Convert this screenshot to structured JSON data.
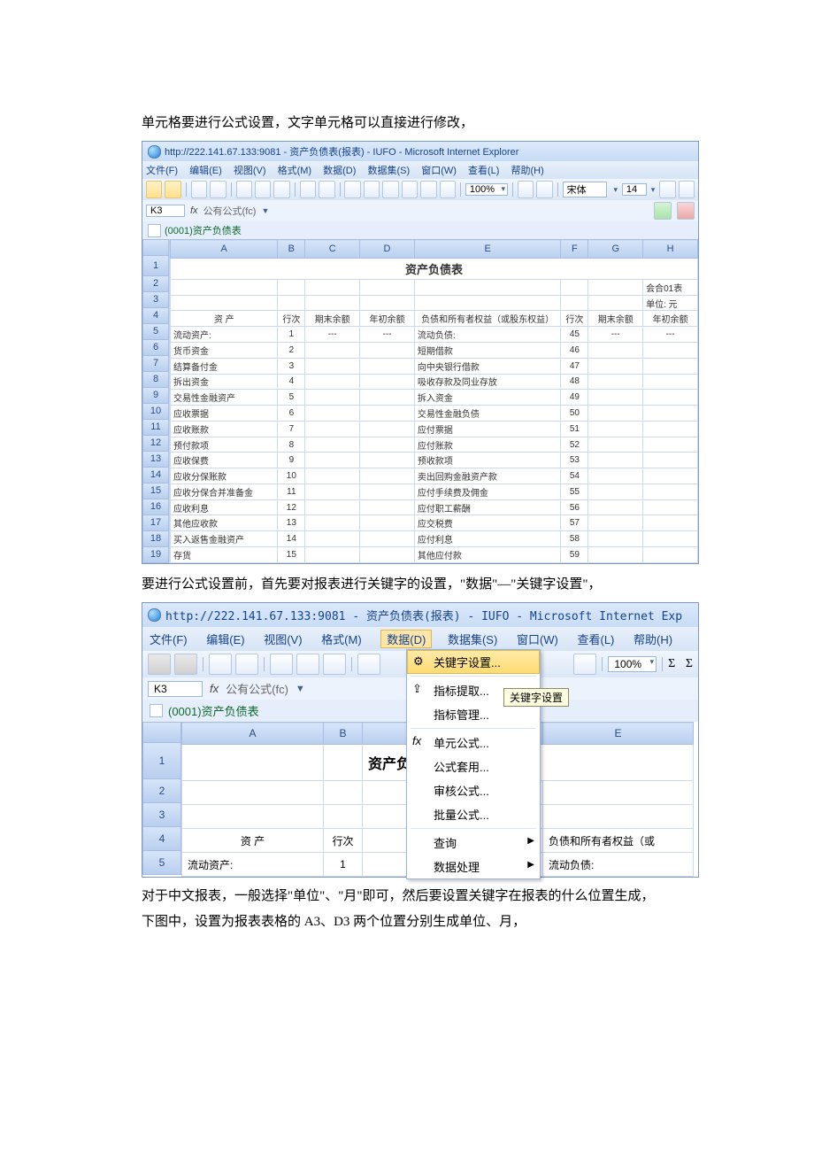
{
  "para1": "单元格要进行公式设置，文字单元格可以直接进行修改，",
  "para2": "要进行公式设置前，首先要对报表进行关键字的设置，\"数据\"—\"关键字设置\"，",
  "para3a": "对于中文报表，一般选择\"单位\"、\"月\"即可，然后要设置关键字在报表的什么位置生成，",
  "para3b": "下图中，设置为报表表格的 A3、D3 两个位置分别生成单位、月，",
  "shot1": {
    "title_url": "http://222.141.67.133:9081 - 资产负债表(报表) - IUFO - Microsoft Internet Explorer",
    "menus": [
      "文件(F)",
      "编辑(E)",
      "视图(V)",
      "格式(M)",
      "数据(D)",
      "数据集(S)",
      "窗口(W)",
      "查看(L)",
      "帮助(H)"
    ],
    "zoom": "100%",
    "font_name": "宋体",
    "font_size": "14",
    "cell_ref": "K3",
    "fx_label": "fx",
    "formula_mode": "公有公式(fc)",
    "tab": "(0001)资产负债表",
    "cols": [
      "A",
      "B",
      "C",
      "D",
      "E",
      "F",
      "G",
      "H"
    ],
    "row_numbers": [
      "1",
      "2",
      "3",
      "4",
      "5",
      "6",
      "7",
      "8",
      "9",
      "10",
      "11",
      "12",
      "13",
      "14",
      "15",
      "16",
      "17",
      "18",
      "19"
    ],
    "title_cell": "资产负债表",
    "r2_h": "会合01表",
    "r3_h": "单位: 元",
    "head": {
      "A": "资 产",
      "B": "行次",
      "C": "期末余额",
      "D": "年初余额",
      "E": "负债和所有者权益（或股东权益）",
      "F": "行次",
      "G": "期末余额",
      "H": "年初余额"
    },
    "rows": [
      {
        "A": "流动资产:",
        "B": "1",
        "C": "---",
        "D": "---",
        "E": "流动负债:",
        "F": "45",
        "G": "---",
        "H": "---"
      },
      {
        "A": "  货币资金",
        "B": "2",
        "C": "",
        "D": "",
        "E": "  短期借款",
        "F": "46",
        "G": "",
        "H": ""
      },
      {
        "A": "  结算备付金",
        "B": "3",
        "C": "",
        "D": "",
        "E": "  向中央银行借款",
        "F": "47",
        "G": "",
        "H": ""
      },
      {
        "A": "  拆出资金",
        "B": "4",
        "C": "",
        "D": "",
        "E": "  吸收存款及同业存放",
        "F": "48",
        "G": "",
        "H": ""
      },
      {
        "A": "  交易性金融资产",
        "B": "5",
        "C": "",
        "D": "",
        "E": "  拆入资金",
        "F": "49",
        "G": "",
        "H": ""
      },
      {
        "A": "  应收票据",
        "B": "6",
        "C": "",
        "D": "",
        "E": "  交易性金融负债",
        "F": "50",
        "G": "",
        "H": ""
      },
      {
        "A": "  应收账款",
        "B": "7",
        "C": "",
        "D": "",
        "E": "  应付票据",
        "F": "51",
        "G": "",
        "H": ""
      },
      {
        "A": "  预付款项",
        "B": "8",
        "C": "",
        "D": "",
        "E": "  应付账款",
        "F": "52",
        "G": "",
        "H": ""
      },
      {
        "A": "  应收保费",
        "B": "9",
        "C": "",
        "D": "",
        "E": "  预收款项",
        "F": "53",
        "G": "",
        "H": ""
      },
      {
        "A": "  应收分保账款",
        "B": "10",
        "C": "",
        "D": "",
        "E": "  卖出回购金融资产款",
        "F": "54",
        "G": "",
        "H": ""
      },
      {
        "A": "  应收分保合并准备金",
        "B": "11",
        "C": "",
        "D": "",
        "E": "  应付手续费及佣金",
        "F": "55",
        "G": "",
        "H": ""
      },
      {
        "A": "  应收利息",
        "B": "12",
        "C": "",
        "D": "",
        "E": "  应付职工薪酬",
        "F": "56",
        "G": "",
        "H": ""
      },
      {
        "A": "  其他应收款",
        "B": "13",
        "C": "",
        "D": "",
        "E": "  应交税费",
        "F": "57",
        "G": "",
        "H": ""
      },
      {
        "A": "  买入返售金融资产",
        "B": "14",
        "C": "",
        "D": "",
        "E": "  应付利息",
        "F": "58",
        "G": "",
        "H": ""
      },
      {
        "A": "  存货",
        "B": "15",
        "C": "",
        "D": "",
        "E": "  其他应付款",
        "F": "59",
        "G": "",
        "H": ""
      }
    ]
  },
  "shot2": {
    "title_url": "http://222.141.67.133:9081 - 资产负债表(报表) - IUFO - Microsoft Internet Exp",
    "menus": [
      "文件(F)",
      "编辑(E)",
      "视图(V)",
      "格式(M)",
      "数据(D)",
      "数据集(S)",
      "窗口(W)",
      "查看(L)",
      "帮助(H)"
    ],
    "menu_selected_index": 4,
    "zoom": "100%",
    "cell_ref": "K3",
    "fx_label": "fx",
    "formula_mode": "公有公式(fc)",
    "tab": "(0001)资产负债表",
    "cols": [
      "A",
      "B",
      "E"
    ],
    "row_numbers": [
      "1",
      "2",
      "3",
      "4",
      "5"
    ],
    "title_cell": "资产负债表",
    "r4": {
      "A": "资 产",
      "B": "行次",
      "extra": "额",
      "E": "负债和所有者权益（或"
    },
    "r5": {
      "A": "流动资产:",
      "B": "1",
      "E": "流动负债:"
    },
    "dropdown": {
      "items": [
        "关键字设置...",
        "指标提取...",
        "指标管理...",
        "单元公式...",
        "公式套用...",
        "审核公式...",
        "批量公式...",
        "查询",
        "数据处理"
      ],
      "highlight_index": 0,
      "submenu_indices": [
        7,
        8
      ]
    },
    "tooltip": "关键字设置"
  }
}
